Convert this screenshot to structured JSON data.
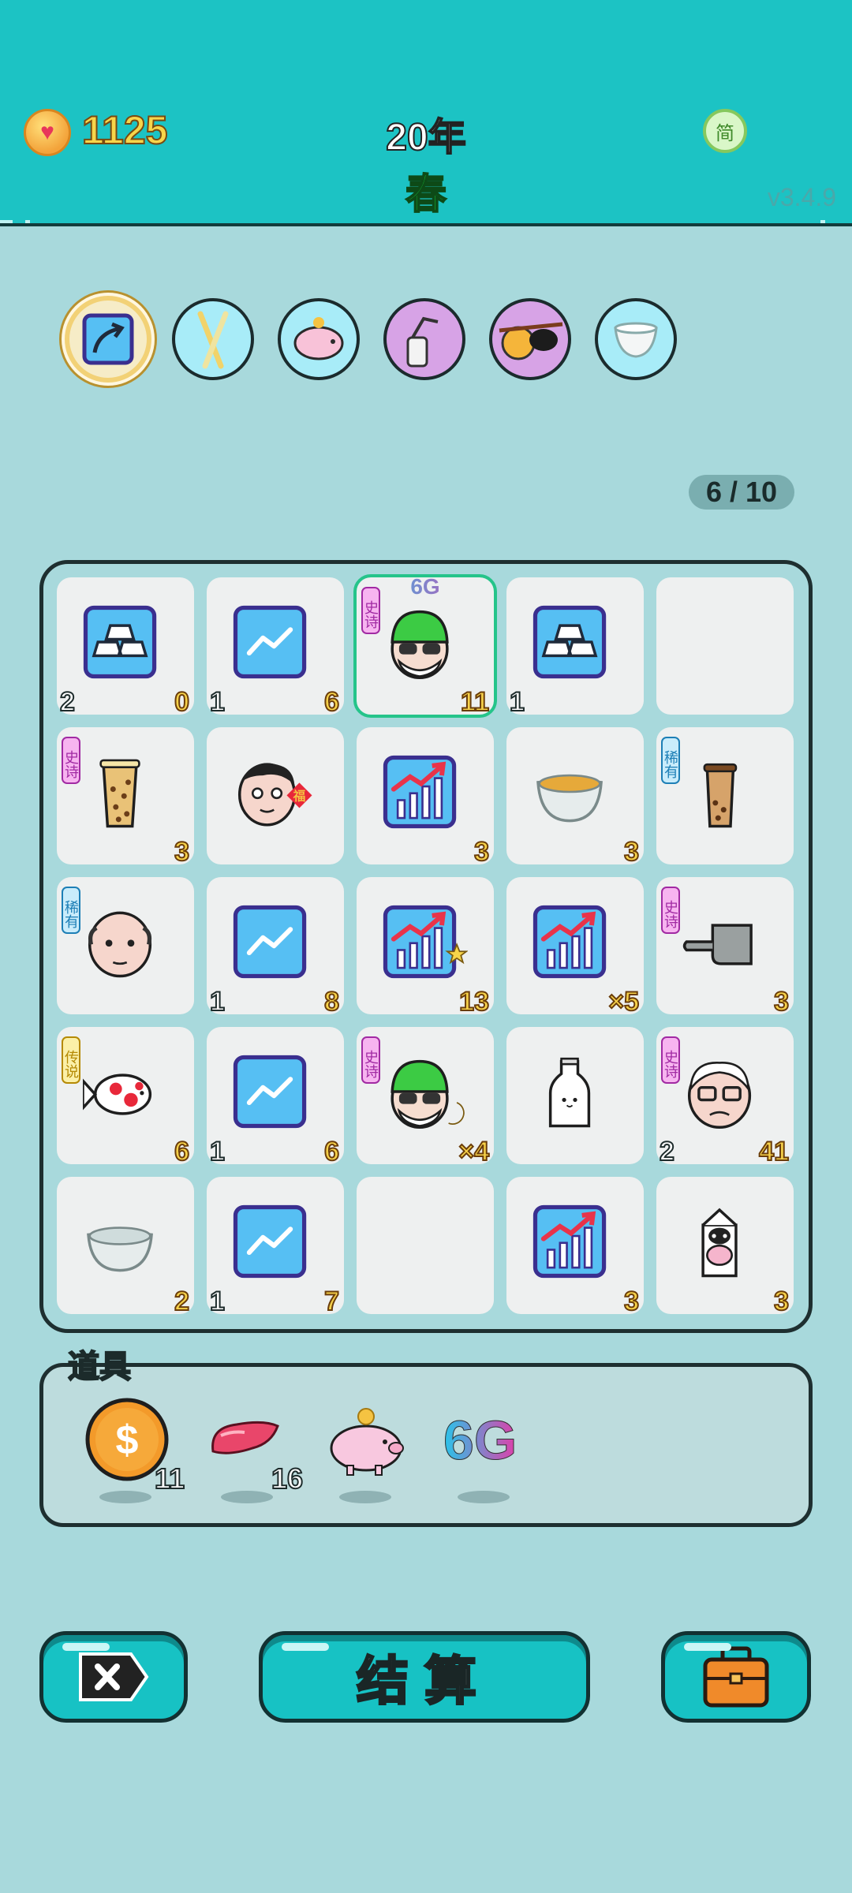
{
  "header": {
    "coins": "1125",
    "year": "20年",
    "season": "春",
    "lang_label": "简",
    "version": "v3.4.9"
  },
  "buffs": [
    {
      "name": "arrow-card",
      "selected": true
    },
    {
      "name": "chopsticks"
    },
    {
      "name": "piggy-bank"
    },
    {
      "name": "spray-bottle"
    },
    {
      "name": "eyepatch-orange"
    },
    {
      "name": "milk-jug"
    }
  ],
  "counter": "6 / 10",
  "board": {
    "cells": [
      {
        "icon": "gold-bars-icon",
        "left": "2",
        "right": "0"
      },
      {
        "icon": "trend-card-icon",
        "left": "1",
        "right": "6"
      },
      {
        "icon": "green-hat-man-icon",
        "tag": "史诗",
        "tag_type": "epic",
        "badge": "6G",
        "right": "11",
        "highlight": true
      },
      {
        "icon": "gold-bars-icon",
        "left": "1"
      },
      {
        "icon": "empty"
      },
      {
        "icon": "bubble-tea-icon",
        "tag": "史诗",
        "tag_type": "epic",
        "right": "3"
      },
      {
        "icon": "fortune-man-icon"
      },
      {
        "icon": "growth-chart-icon",
        "right": "3"
      },
      {
        "icon": "soup-bowl-icon",
        "right": "3"
      },
      {
        "icon": "bubble-tea-small-icon",
        "tag": "稀有",
        "tag_type": "rare"
      },
      {
        "icon": "bald-man-icon",
        "tag": "稀有",
        "tag_type": "rare"
      },
      {
        "icon": "trend-card-icon",
        "left": "1",
        "right": "8"
      },
      {
        "icon": "growth-chart-star-icon",
        "right": "13"
      },
      {
        "icon": "growth-chart-icon",
        "right": "×5"
      },
      {
        "icon": "pointing-hand-icon",
        "tag": "史诗",
        "tag_type": "epic",
        "right": "3"
      },
      {
        "icon": "koi-fish-icon",
        "tag": "传说",
        "tag_type": "legend",
        "right": "6"
      },
      {
        "icon": "trend-card-icon",
        "left": "1",
        "right": "6"
      },
      {
        "icon": "green-hat-man-moon-icon",
        "tag": "史诗",
        "tag_type": "epic",
        "right": "×4"
      },
      {
        "icon": "milk-bottle-icon"
      },
      {
        "icon": "old-man-glasses-icon",
        "tag": "史诗",
        "tag_type": "epic",
        "left": "2",
        "right": "41"
      },
      {
        "icon": "empty-bowl-icon",
        "right": "2"
      },
      {
        "icon": "trend-card-icon",
        "left": "1",
        "right": "7"
      },
      {
        "icon": "empty"
      },
      {
        "icon": "growth-chart-icon",
        "right": "3"
      },
      {
        "icon": "milk-carton-cow-icon",
        "right": "3"
      }
    ]
  },
  "items": {
    "label": "道具",
    "list": [
      {
        "icon": "dollar-coin-icon",
        "count": "11"
      },
      {
        "icon": "liver-icon",
        "count": "16"
      },
      {
        "icon": "piggy-bank-icon"
      },
      {
        "icon": "6g-icon",
        "text": "6G"
      }
    ]
  },
  "buttons": {
    "settle_label": "结算"
  },
  "colors": {
    "header_bg": "#1cc3c4",
    "page_bg": "#a8d9dc",
    "button_bg": "#17c2c4",
    "coin_text": "#f7d54a",
    "season_text": "#16c83a"
  }
}
